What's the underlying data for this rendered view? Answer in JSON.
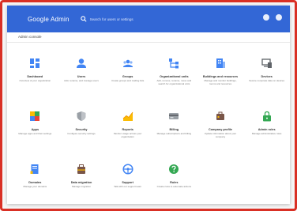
{
  "header": {
    "brand": "Google Admin",
    "search_placeholder": "Search for users or settings"
  },
  "breadcrumb": "Admin console",
  "tiles": [
    {
      "title": "Dashboard",
      "desc": "Overview of your organization",
      "icon": "dashboard-icon",
      "color": "#4285f4"
    },
    {
      "title": "Users",
      "desc": "Add, rename, and manage users",
      "icon": "user-icon",
      "color": "#4285f4"
    },
    {
      "title": "Groups",
      "desc": "Create groups and mailing lists",
      "icon": "groups-icon",
      "color": "#4285f4"
    },
    {
      "title": "Organizational units",
      "desc": "Add, remove, rename, move and search for organizational units",
      "icon": "org-units-icon",
      "color": "#4285f4"
    },
    {
      "title": "Buildings and resources",
      "desc": "Manage and monitor buildings, rooms and resources",
      "icon": "building-icon",
      "color": "#4285f4"
    },
    {
      "title": "Devices",
      "desc": "Secure corporate data on devices",
      "icon": "devices-icon",
      "color": "#5f6368"
    },
    {
      "title": "Apps",
      "desc": "Manage apps and their settings",
      "icon": "apps-icon",
      "color": "#fbbc04"
    },
    {
      "title": "Security",
      "desc": "Configure security settings",
      "icon": "shield-icon",
      "color": "#9aa0a6"
    },
    {
      "title": "Reports",
      "desc": "Monitor usage across your organization",
      "icon": "reports-icon",
      "color": "#fbbc04"
    },
    {
      "title": "Billing",
      "desc": "Manage subscriptions and billing",
      "icon": "billing-icon",
      "color": "#9aa0a6"
    },
    {
      "title": "Company profile",
      "desc": "Update information about your company",
      "icon": "company-profile-icon",
      "color": "#795548"
    },
    {
      "title": "Admin roles",
      "desc": "Manage administrative roles",
      "icon": "lock-icon",
      "color": "#34a853"
    },
    {
      "title": "Domains",
      "desc": "Manage your domains",
      "icon": "domains-icon",
      "color": "#4285f4"
    },
    {
      "title": "Data migration",
      "desc": "Manage migration",
      "icon": "migration-icon",
      "color": "#795548"
    },
    {
      "title": "Support",
      "desc": "Talk with our support team",
      "icon": "support-icon",
      "color": "#4285f4"
    },
    {
      "title": "Rules",
      "desc": "Create rules to automate actions",
      "icon": "help-icon",
      "color": "#34a853"
    }
  ]
}
